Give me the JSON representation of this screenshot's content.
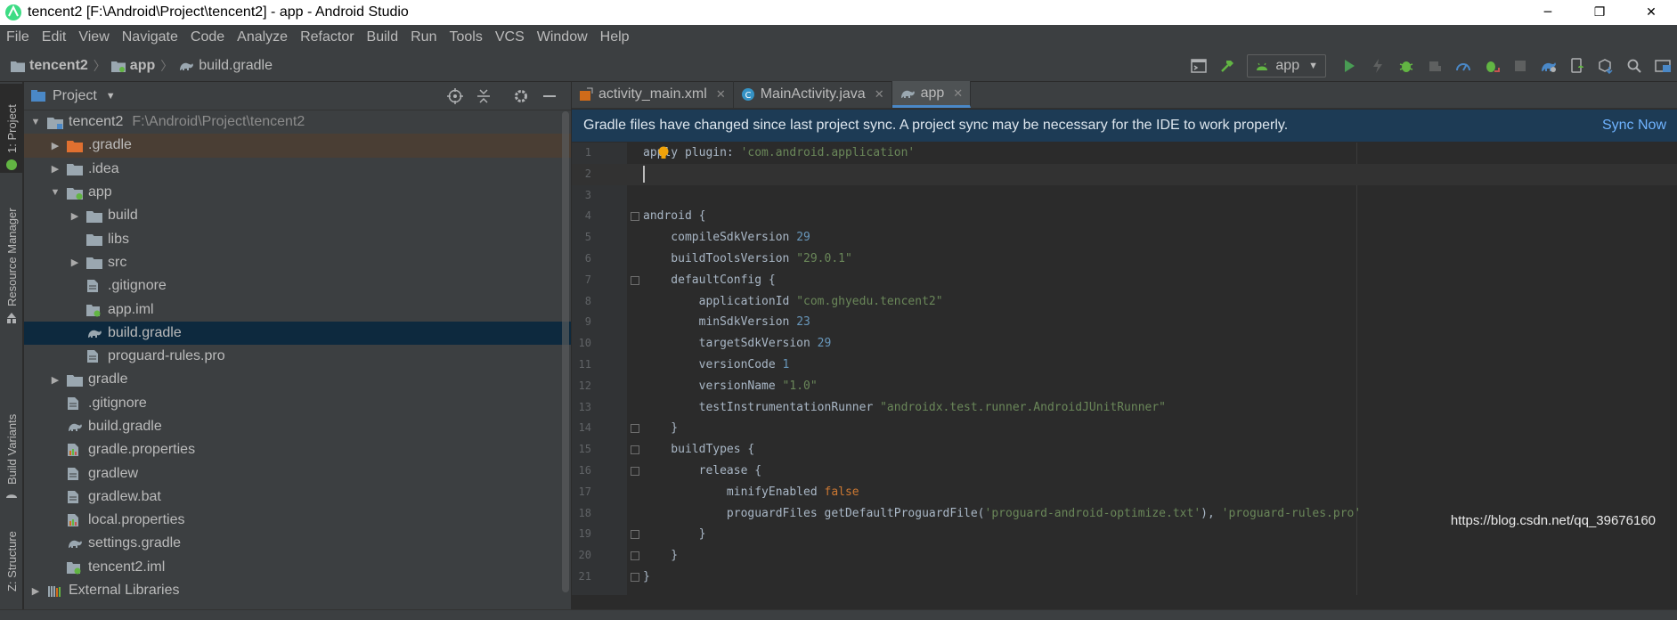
{
  "window": {
    "title": "tencent2 [F:\\Android\\Project\\tencent2] - app - Android Studio",
    "minimize": "─",
    "restore": "❐",
    "close": "✕"
  },
  "menu": [
    "File",
    "Edit",
    "View",
    "Navigate",
    "Code",
    "Analyze",
    "Refactor",
    "Build",
    "Run",
    "Tools",
    "VCS",
    "Window",
    "Help"
  ],
  "breadcrumb": [
    "tencent2",
    "app",
    "build.gradle"
  ],
  "toolbar": {
    "run_config": "app"
  },
  "left_tabs": {
    "project": "1: Project",
    "resource_manager": "Resource Manager",
    "build_variants": "Build Variants",
    "structure": "Z: Structure"
  },
  "project_panel": {
    "title": "Project",
    "tree": [
      {
        "label": "tencent2",
        "path": "F:\\Android\\Project\\tencent2",
        "depth": 0,
        "expand": "open",
        "icon": "module-folder-icon"
      },
      {
        "label": ".gradle",
        "depth": 1,
        "expand": "closed",
        "icon": "orange-folder-icon",
        "state": "highlighted"
      },
      {
        "label": ".idea",
        "depth": 1,
        "expand": "closed",
        "icon": "folder-icon"
      },
      {
        "label": "app",
        "depth": 1,
        "expand": "open",
        "icon": "android-module-folder-icon"
      },
      {
        "label": "build",
        "depth": 2,
        "expand": "closed",
        "icon": "folder-icon"
      },
      {
        "label": "libs",
        "depth": 2,
        "expand": "none",
        "icon": "folder-icon"
      },
      {
        "label": "src",
        "depth": 2,
        "expand": "closed",
        "icon": "folder-icon"
      },
      {
        "label": ".gitignore",
        "depth": 2,
        "expand": "none",
        "icon": "text-file-icon"
      },
      {
        "label": "app.iml",
        "depth": 2,
        "expand": "none",
        "icon": "iml-file-icon"
      },
      {
        "label": "build.gradle",
        "depth": 2,
        "expand": "none",
        "icon": "gradle-file-icon",
        "state": "selected"
      },
      {
        "label": "proguard-rules.pro",
        "depth": 2,
        "expand": "none",
        "icon": "text-file-icon"
      },
      {
        "label": "gradle",
        "depth": 1,
        "expand": "closed",
        "icon": "folder-icon"
      },
      {
        "label": ".gitignore",
        "depth": 1,
        "expand": "none",
        "icon": "text-file-icon"
      },
      {
        "label": "build.gradle",
        "depth": 1,
        "expand": "none",
        "icon": "gradle-file-icon"
      },
      {
        "label": "gradle.properties",
        "depth": 1,
        "expand": "none",
        "icon": "properties-file-icon"
      },
      {
        "label": "gradlew",
        "depth": 1,
        "expand": "none",
        "icon": "text-file-icon"
      },
      {
        "label": "gradlew.bat",
        "depth": 1,
        "expand": "none",
        "icon": "text-file-icon"
      },
      {
        "label": "local.properties",
        "depth": 1,
        "expand": "none",
        "icon": "properties-file-icon"
      },
      {
        "label": "settings.gradle",
        "depth": 1,
        "expand": "none",
        "icon": "gradle-file-icon"
      },
      {
        "label": "tencent2.iml",
        "depth": 1,
        "expand": "none",
        "icon": "iml-file-icon"
      },
      {
        "label": "External Libraries",
        "depth": 0,
        "expand": "closed",
        "icon": "library-icon"
      }
    ]
  },
  "editor": {
    "tabs": [
      {
        "label": "activity_main.xml",
        "icon": "xml-file-icon",
        "active": false
      },
      {
        "label": "MainActivity.java",
        "icon": "java-class-icon",
        "active": false
      },
      {
        "label": "app",
        "icon": "gradle-file-icon",
        "active": true
      }
    ],
    "banner": {
      "message": "Gradle files have changed since last project sync. A project sync may be necessary for the IDE to work properly.",
      "action": "Sync Now"
    },
    "lines": [
      [
        [
          "apply plugin: ",
          "t"
        ],
        [
          "'com.android.application'",
          "s"
        ]
      ],
      [],
      [],
      [
        [
          "android {",
          "t"
        ]
      ],
      [
        [
          "    compileSdkVersion ",
          "t"
        ],
        [
          "29",
          "n"
        ]
      ],
      [
        [
          "    buildToolsVersion ",
          "t"
        ],
        [
          "\"29.0.1\"",
          "s"
        ]
      ],
      [
        [
          "    defaultConfig {",
          "t"
        ]
      ],
      [
        [
          "        applicationId ",
          "t"
        ],
        [
          "\"com.ghyedu.tencent2\"",
          "s"
        ]
      ],
      [
        [
          "        minSdkVersion ",
          "t"
        ],
        [
          "23",
          "n"
        ]
      ],
      [
        [
          "        targetSdkVersion ",
          "t"
        ],
        [
          "29",
          "n"
        ]
      ],
      [
        [
          "        versionCode ",
          "t"
        ],
        [
          "1",
          "n"
        ]
      ],
      [
        [
          "        versionName ",
          "t"
        ],
        [
          "\"1.0\"",
          "s"
        ]
      ],
      [
        [
          "        testInstrumentationRunner ",
          "t"
        ],
        [
          "\"androidx.test.runner.AndroidJUnitRunner\"",
          "s"
        ]
      ],
      [
        [
          "    }",
          "t"
        ]
      ],
      [
        [
          "    buildTypes {",
          "t"
        ]
      ],
      [
        [
          "        release {",
          "t"
        ]
      ],
      [
        [
          "            minifyEnabled ",
          "t"
        ],
        [
          "false",
          "k"
        ]
      ],
      [
        [
          "            proguardFiles getDefaultProguardFile(",
          "t"
        ],
        [
          "'proguard-android-optimize.txt'",
          "s"
        ],
        [
          "), ",
          "t"
        ],
        [
          "'proguard-rules.pro'",
          "s"
        ]
      ],
      [
        [
          "        }",
          "t"
        ]
      ],
      [
        [
          "    }",
          "t"
        ]
      ],
      [
        [
          "}",
          "t"
        ]
      ]
    ],
    "fold_lines": [
      4,
      7,
      14,
      15,
      16,
      19,
      20,
      21
    ]
  },
  "watermark": "https://blog.csdn.net/qq_39676160"
}
